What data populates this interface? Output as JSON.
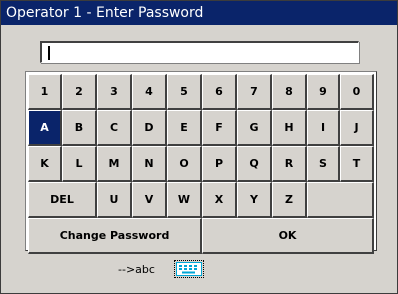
{
  "window": {
    "title": "Operator 1 - Enter Password"
  },
  "password": {
    "value": ""
  },
  "keys": {
    "row1": [
      "1",
      "2",
      "3",
      "4",
      "5",
      "6",
      "7",
      "8",
      "9",
      "0"
    ],
    "row2": [
      "A",
      "B",
      "C",
      "D",
      "E",
      "F",
      "G",
      "H",
      "I",
      "J"
    ],
    "row3": [
      "K",
      "L",
      "M",
      "N",
      "O",
      "P",
      "Q",
      "R",
      "S",
      "T"
    ],
    "row4": [
      "DEL",
      "U",
      "V",
      "W",
      "X",
      "Y",
      "Z"
    ],
    "selected": "A",
    "change_password": "Change Password",
    "ok": "OK"
  },
  "footer": {
    "mode_text": "-->abc",
    "keyboard_icon": "keyboard-icon"
  }
}
